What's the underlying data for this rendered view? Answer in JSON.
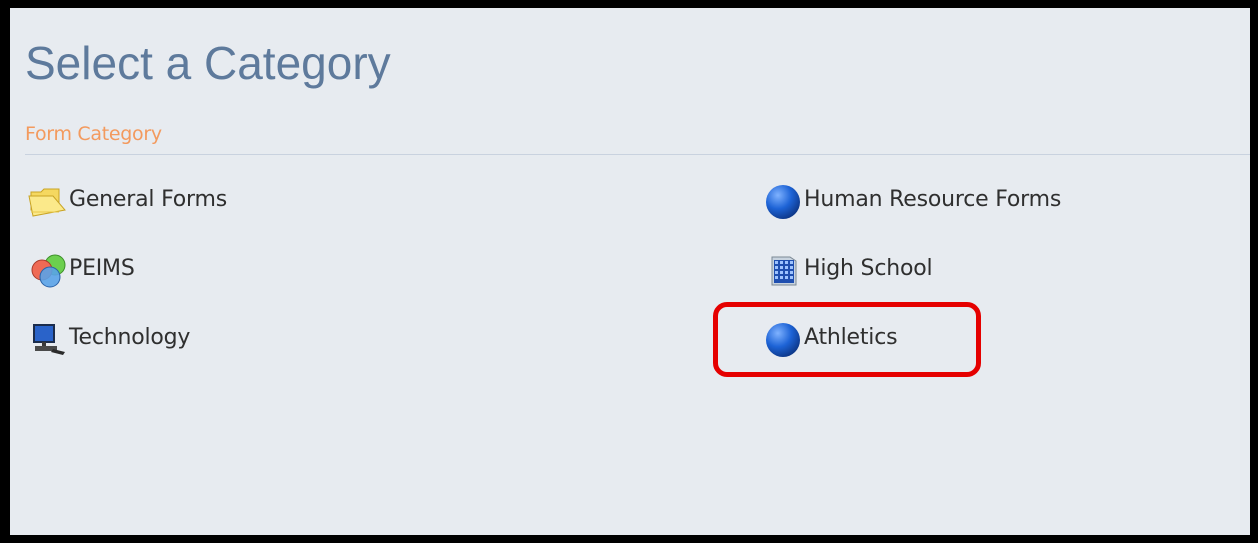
{
  "page": {
    "title": "Select a Category",
    "section_label": "Form Category"
  },
  "categories": [
    {
      "label": "General Forms",
      "icon": "folder-icon"
    },
    {
      "label": "Human Resource Forms",
      "icon": "globe-icon"
    },
    {
      "label": "PEIMS",
      "icon": "colored-circles-icon"
    },
    {
      "label": "High School",
      "icon": "building-icon"
    },
    {
      "label": "Technology",
      "icon": "computer-icon"
    },
    {
      "label": "Athletics",
      "icon": "globe-icon"
    }
  ],
  "colors": {
    "title": "#5e7a9c",
    "section_label": "#f39a5e",
    "background": "#e7ebf0",
    "highlight": "#e50000"
  }
}
